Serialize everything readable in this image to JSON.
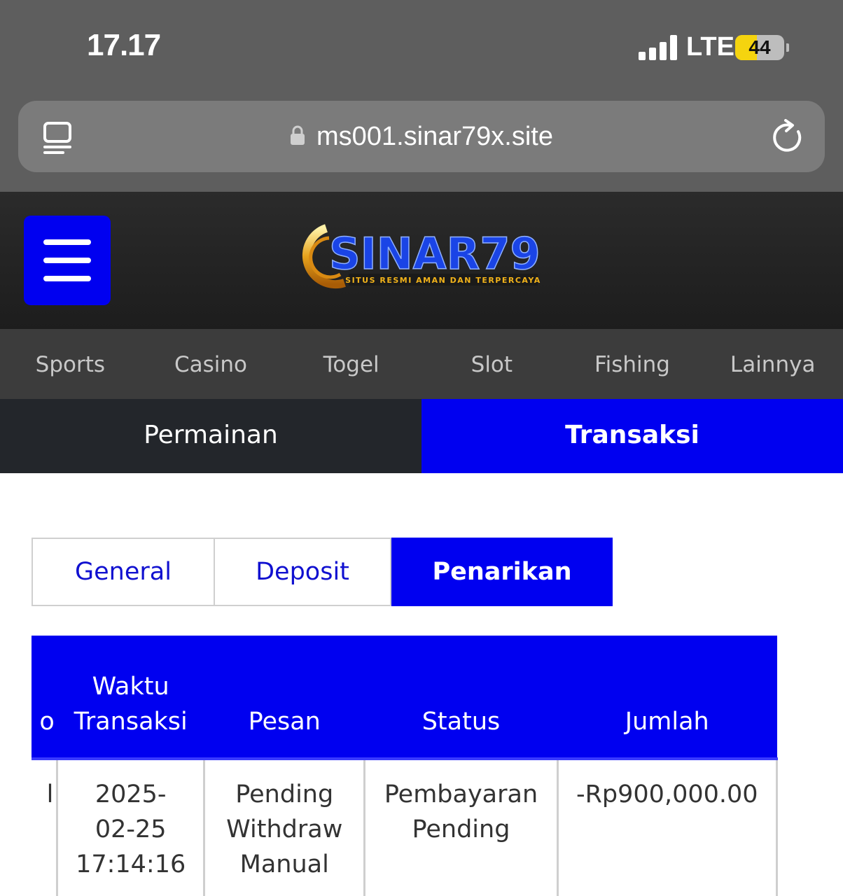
{
  "status_bar": {
    "time": "17.17",
    "network": "LTE",
    "battery_percent": 44
  },
  "browser": {
    "url": "ms001.sinar79x.site"
  },
  "header": {
    "logo_text": "SINAR79",
    "logo_tagline": "SITUS RESMI AMAN DAN TERPERCAYA"
  },
  "categories": [
    "Sports",
    "Casino",
    "Togel",
    "Slot",
    "Fishing",
    "Lainnya"
  ],
  "main_tabs": {
    "permainan": "Permainan",
    "transaksi": "Transaksi",
    "active": "Transaksi"
  },
  "sub_tabs": {
    "general": "General",
    "deposit": "Deposit",
    "penarikan": "Penarikan",
    "active": "Penarikan"
  },
  "table": {
    "headers": [
      "o",
      "Waktu Transaksi",
      "Pesan",
      "Status",
      "Jumlah"
    ],
    "rows": [
      {
        "no": "l",
        "waktu": "2025-02-25 17:14:16",
        "pesan": "Pending Withdraw Manual",
        "status": "Pembayaran Pending",
        "jumlah": "-Rp900,000.00"
      }
    ]
  },
  "colors": {
    "accent": "#0000f0",
    "header_bg": "#262626",
    "nav_bg": "#3c3c3c"
  }
}
